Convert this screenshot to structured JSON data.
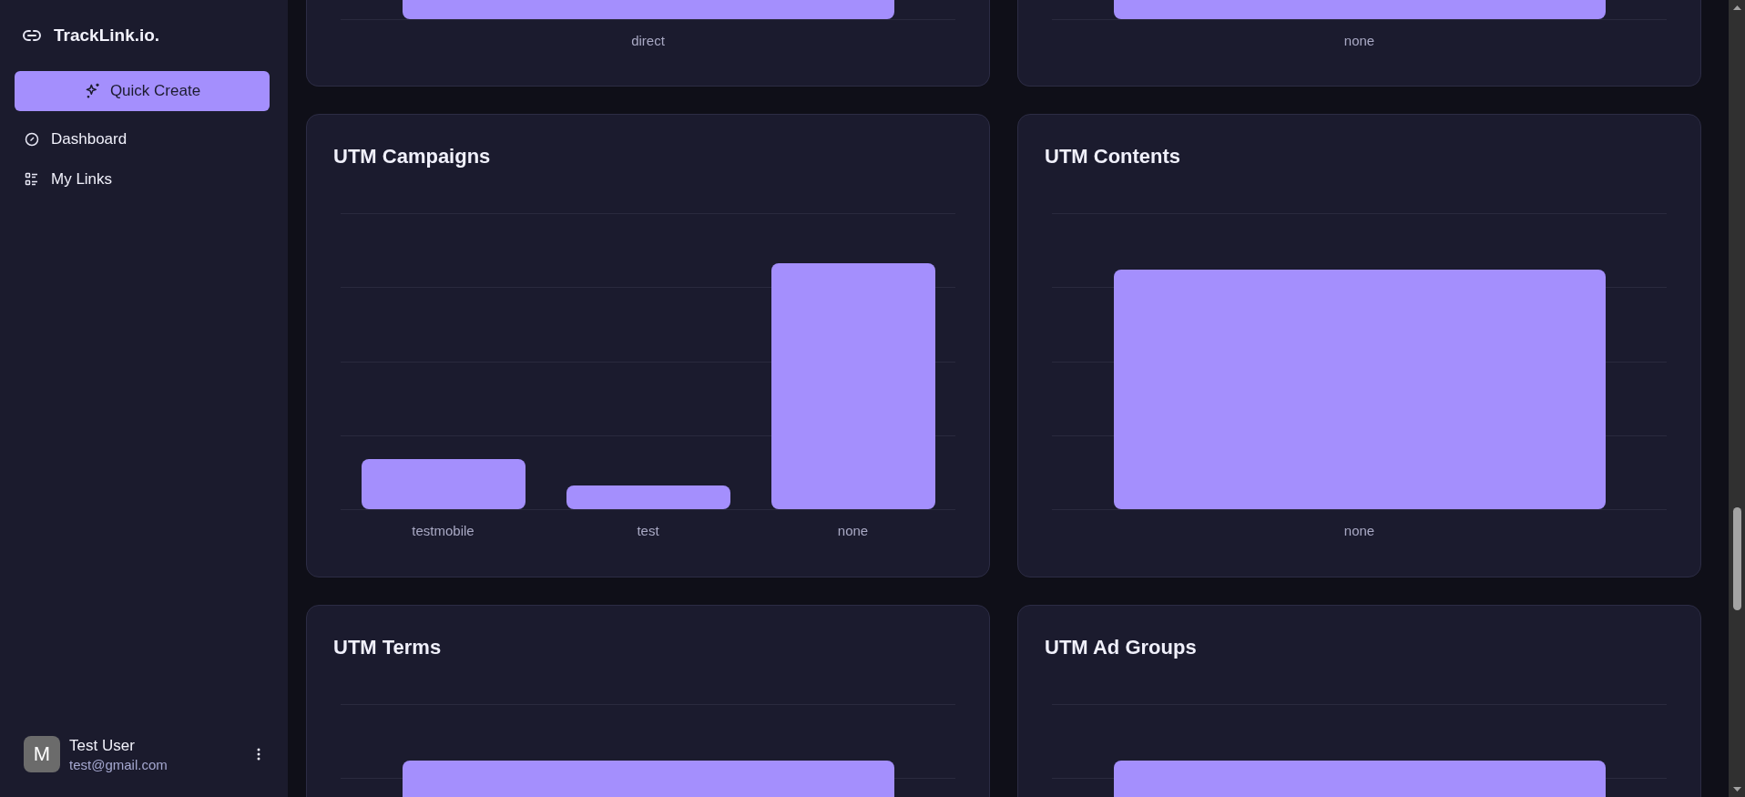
{
  "brand": {
    "name": "TrackLink.io."
  },
  "quick_create": {
    "label": "Quick Create"
  },
  "nav": [
    {
      "label": "Dashboard",
      "kind": "dashboard"
    },
    {
      "label": "My Links",
      "kind": "links"
    }
  ],
  "user": {
    "avatar_initial": "M",
    "name": "Test User",
    "email": "test@gmail.com"
  },
  "cards": [
    {
      "bars": [
        {
          "label": "direct"
        }
      ]
    },
    {
      "bars": [
        {
          "label": "none"
        }
      ]
    },
    {
      "title": "UTM Campaigns",
      "bars": [
        {
          "label": "testmobile"
        },
        {
          "label": "test"
        },
        {
          "label": "none"
        }
      ]
    },
    {
      "title": "UTM Contents",
      "bars": [
        {
          "label": "none"
        }
      ]
    },
    {
      "title": "UTM Terms"
    },
    {
      "title": "UTM Ad Groups"
    }
  ]
}
